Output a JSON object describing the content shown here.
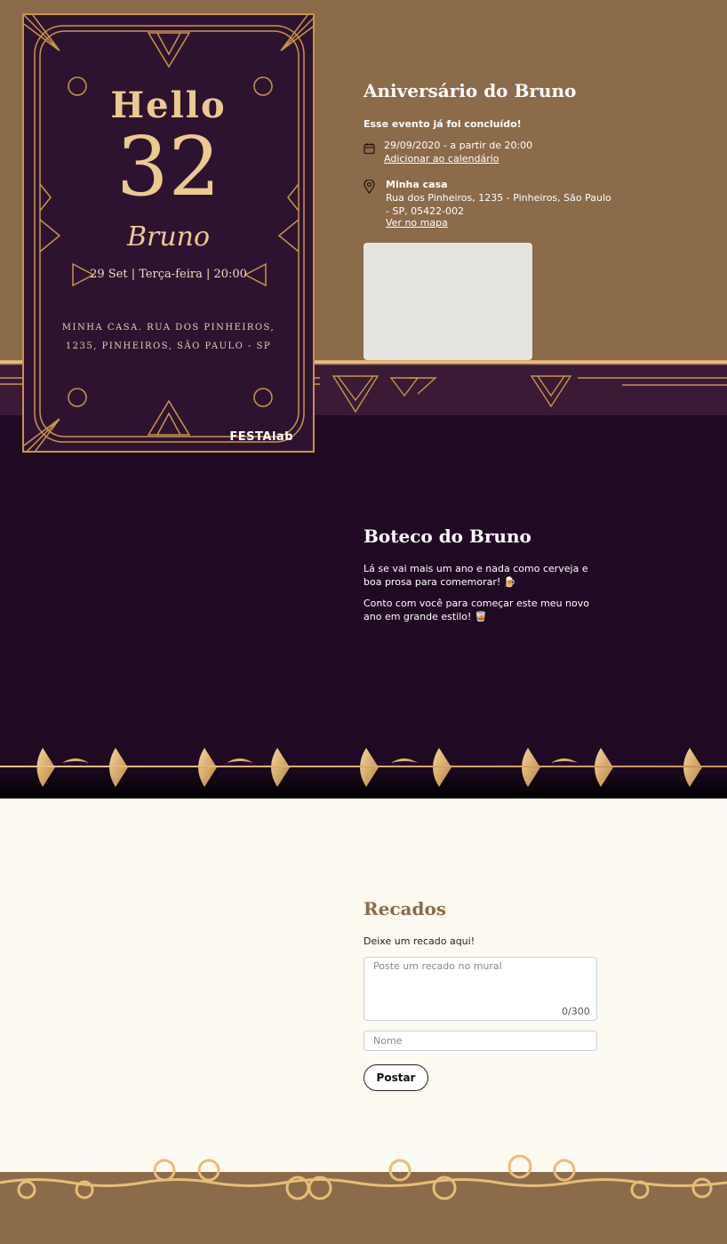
{
  "invitation": {
    "hello": "Hello",
    "age": "32",
    "name": "Bruno",
    "date_line": "29 Set | Terça-feira | 20:00",
    "address_line1": "MINHA CASA. RUA DOS PINHEIROS,",
    "address_line2": "1235, PINHEIROS, SÃO PAULO - SP",
    "brand": "FESTAlab"
  },
  "event": {
    "title": "Aniversário do Bruno",
    "status": "Esse evento já foi concluído!",
    "date": "29/09/2020 - a partir de 20:00",
    "calendar_link": "Adicionar ao calendário",
    "place_name": "Minha casa",
    "place_address": "Rua dos Pinheiros, 1235 - Pinheiros, São Paulo - SP, 05422-002",
    "map_link": "Ver no mapa"
  },
  "about": {
    "title": "Boteco do Bruno",
    "paragraph1": "Lá se vai mais um ano e nada como cerveja e boa prosa para comemorar! 🍺",
    "paragraph2": "Conto com você para começar este meu novo ano em grande estilo! 🥃"
  },
  "messages": {
    "title": "Recados",
    "subtitle": "Deixe um recado aqui!",
    "message_placeholder": "Poste um recado no mural",
    "char_count": "0/300",
    "name_placeholder": "Nome",
    "post_label": "Postar"
  },
  "colors": {
    "brown": "#8b6b4a",
    "purple_dark": "#200a23",
    "gold": "#d9a35f",
    "cream": "#fdfaf1"
  }
}
